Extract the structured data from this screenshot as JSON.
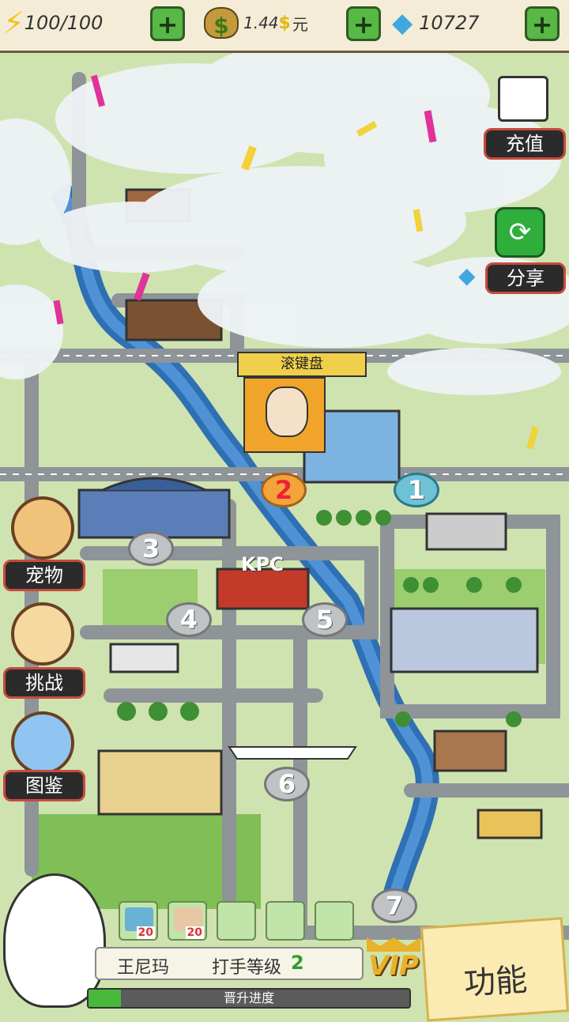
{
  "resources": {
    "energy": "100/100",
    "money": "1.44",
    "money_unit": "元",
    "diamonds": "10727"
  },
  "right_buttons": {
    "recharge": "充值",
    "share": "分享"
  },
  "left_buttons": {
    "pet": "宠物",
    "challenge": "挑战",
    "collection": "图鉴"
  },
  "map": {
    "kpc_sign": "KPC",
    "popup_label": "滚键盘",
    "nodes": [
      "1",
      "2",
      "3",
      "4",
      "5",
      "6",
      "7"
    ]
  },
  "bottom": {
    "player_line": "王尼玛",
    "level_label": "打手等级",
    "level_value": "2",
    "progress_label": "晋升进度",
    "progress": 0.1,
    "vip": "VIP",
    "function_button": "功能",
    "item_counts": [
      "20",
      "20"
    ]
  }
}
